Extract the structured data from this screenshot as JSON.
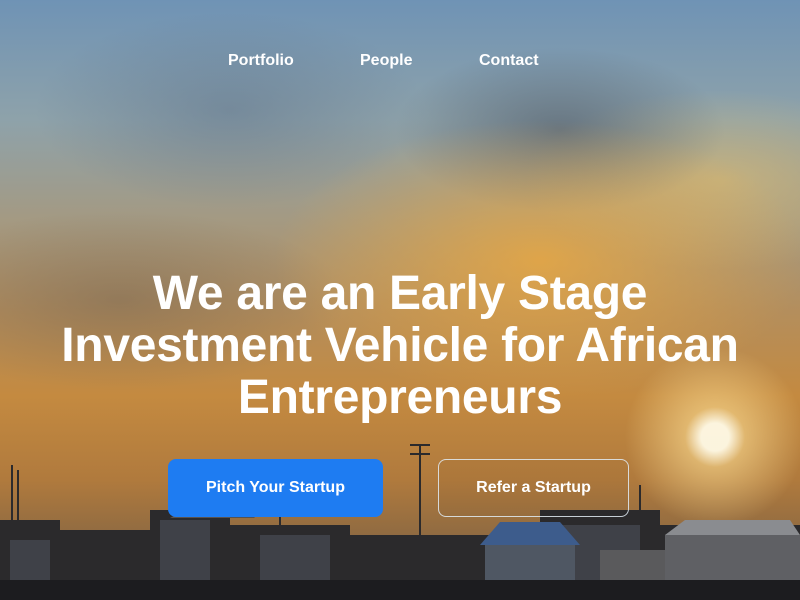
{
  "nav": {
    "items": [
      {
        "label": "Portfolio"
      },
      {
        "label": "People"
      },
      {
        "label": "Contact"
      }
    ]
  },
  "hero": {
    "headline_lines": [
      "We are an Early Stage",
      "Investment Vehicle for African",
      "Entrepreneurs"
    ],
    "primary_button": "Pitch Your Startup",
    "secondary_button": "Refer a Startup"
  },
  "colors": {
    "primary_button": "#1e7cf2",
    "text": "#ffffff"
  }
}
